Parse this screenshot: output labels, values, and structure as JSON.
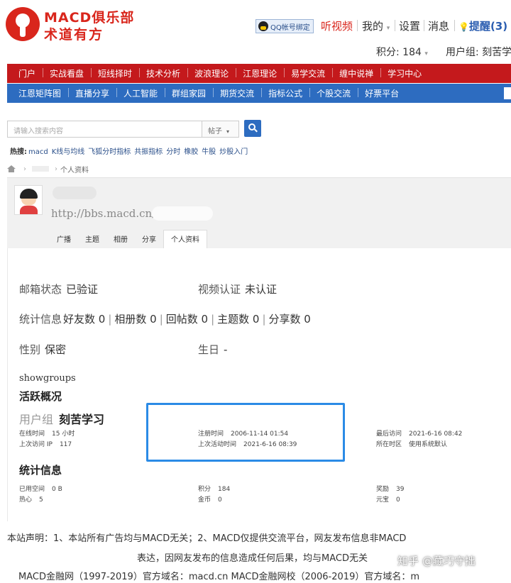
{
  "header": {
    "logo_title": "MACD俱乐部",
    "logo_subtitle": "术道有方",
    "qq_badge": "QQ帐号绑定",
    "links": {
      "video": "听视频",
      "mine": "我的",
      "settings": "设置",
      "messages": "消息",
      "remind": "提醒(3)"
    },
    "points_label": "积分: 184",
    "usergroup_label": "用户组: 刻苦学"
  },
  "nav_primary": [
    "门户",
    "实战看盘",
    "短线择时",
    "技术分析",
    "波浪理论",
    "江恩理论",
    "易学交流",
    "缠中说禅",
    "学习中心"
  ],
  "nav_secondary": [
    "江恩矩阵图",
    "直播分享",
    "人工智能",
    "群组家园",
    "期货交流",
    "指标公式",
    "个股交流",
    "好票平台"
  ],
  "search": {
    "placeholder": "请输入搜索内容",
    "type": "帖子",
    "hot_label": "热搜:",
    "hot_keywords": [
      "macd",
      "K线与均线",
      "飞狐分时指标",
      "共振指标",
      "分时",
      "橡胶",
      "牛股",
      "炒股入门"
    ]
  },
  "breadcrumb": {
    "current": "个人资料"
  },
  "profile": {
    "url": "http://bbs.macd.cn/",
    "tabs": [
      "广播",
      "主题",
      "相册",
      "分享",
      "个人资料"
    ],
    "active_tab": "个人资料"
  },
  "info": {
    "email_label": "邮箱状态",
    "email_value": "已验证",
    "video_label": "视频认证",
    "video_value": "未认证",
    "stats_label": "统计信息",
    "stats": [
      "好友数 0",
      "相册数 0",
      "回帖数 0",
      "主题数 0",
      "分享数 0"
    ],
    "gender_label": "性别",
    "gender_value": "保密",
    "birthday_label": "生日",
    "birthday_value": "-",
    "showgroups": "showgroups",
    "activity_title": "活跃概况",
    "usergroup_label": "用户组",
    "usergroup_value": "刻苦学习",
    "online_label": "在线时间",
    "online_value": "15 小时",
    "last_ip_label": "上次访问 IP",
    "last_ip_value": "117",
    "reg_label": "注册时间",
    "reg_value": "2006-11-14 01:54",
    "last_active_label": "上次活动时间",
    "last_active_value": "2021-6-16 08:39",
    "last_visit_label": "最后访问",
    "last_visit_value": "2021-6-16 08:42",
    "timezone_label": "所在时区",
    "timezone_value": "使用系统默认",
    "stats_title": "统计信息",
    "space_label": "已用空间",
    "space_value": "0 B",
    "heart_label": "热心",
    "heart_value": "5",
    "score_label": "积分",
    "score_value": "184",
    "coin_label": "金币",
    "coin_value": "0",
    "reward_label": "奖励",
    "reward_value": "39",
    "treasure_label": "元宝",
    "treasure_value": "0"
  },
  "footer": {
    "line1": "本站声明：1、本站所有广告均与MACD无关；2、MACD仅提供交流平台，网友发布信息非MACD",
    "line2": "表达，因网友发布的信息造成任何后果，均与MACD无关",
    "line3": "MACD金融网（1997-2019）官方域名：macd.cn      MACD金融网校（2006-2019）官方域名：m",
    "watermark": "知乎 @藏巧守拙"
  },
  "colors": {
    "brand_red": "#d9261c",
    "nav_red": "#c4191c",
    "nav_blue": "#2d6cc0",
    "highlight_blue": "#2b8be6"
  }
}
